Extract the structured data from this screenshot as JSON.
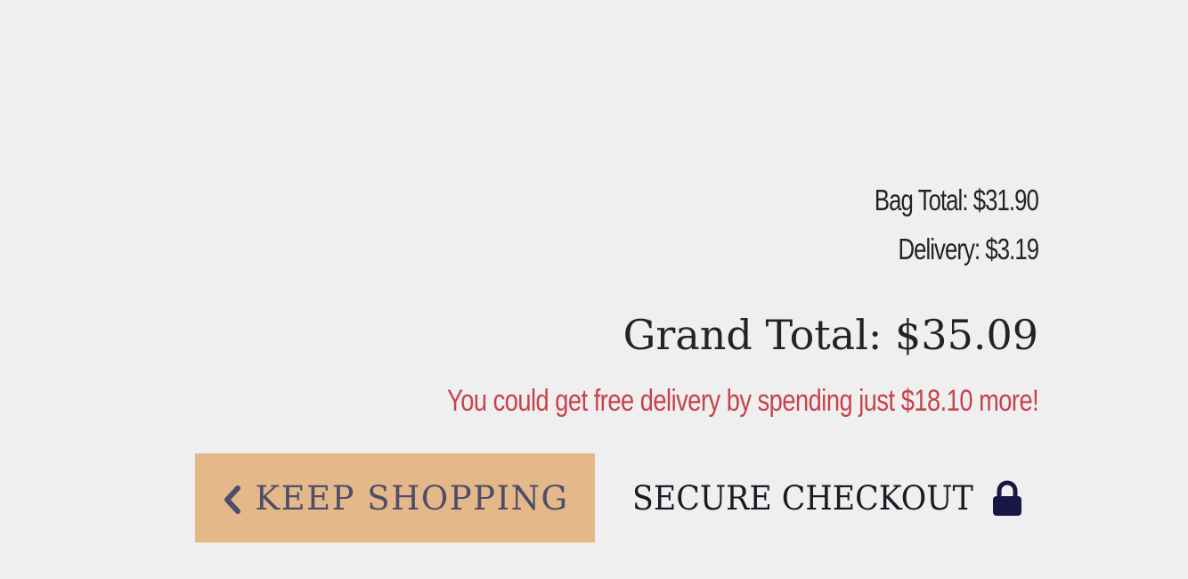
{
  "summary": {
    "bag_total": "Bag Total: $31.90",
    "delivery": "Delivery: $3.19",
    "grand_total": "Grand Total: $35.09",
    "free_delivery_notice": "You could get free delivery by spending just $18.10 more!"
  },
  "actions": {
    "keep_shopping_label": "KEEP SHOPPING",
    "keep_shopping_icon": "chevron-left-icon",
    "secure_checkout_label": "SECURE CHECKOUT",
    "secure_checkout_icon": "lock-icon"
  },
  "colors": {
    "background": "#efefef",
    "keep_shopping_bg": "#e5b889",
    "keep_shopping_text": "#4e4d6a",
    "notice_text": "#c7424b",
    "lock_icon": "#171744"
  }
}
